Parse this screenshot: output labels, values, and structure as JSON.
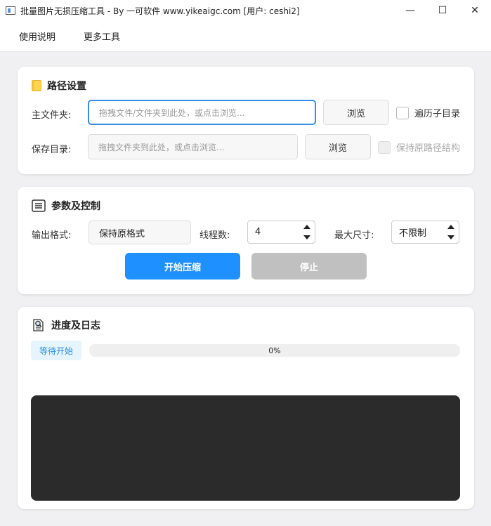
{
  "window": {
    "title": "批量图片无损压缩工具 - By 一可软件 www.yikeaigc.com [用户: ceshi2]",
    "minimize_glyph": "—",
    "maximize_glyph": "☐",
    "close_glyph": "✕"
  },
  "menu": {
    "items": [
      {
        "label": "使用说明"
      },
      {
        "label": "更多工具"
      }
    ]
  },
  "path_settings": {
    "title": "路径设置",
    "title_icon": "folder-icon",
    "main_folder_label": "主文件夹:",
    "main_folder_placeholder": "拖拽文件/文件夹到此处，或点击浏览...",
    "browse_label": "浏览",
    "recursive_label": "遍历子目录",
    "save_dir_label": "保存目录:",
    "save_dir_placeholder": "拖拽文件夹到此处，或点击浏览...",
    "save_browse_label": "浏览",
    "keep_structure_label": "保持原路径结构"
  },
  "params": {
    "title": "参数及控制",
    "title_icon": "list-icon",
    "format_label": "输出格式:",
    "format_value": "保持原格式",
    "threads_label": "线程数:",
    "threads_value": "4",
    "max_size_label": "最大尺寸:",
    "max_size_value": "不限制",
    "start_label": "开始压缩",
    "stop_label": "停止"
  },
  "progress": {
    "title": "进度及日志",
    "title_icon": "magnifier-document-icon",
    "status": "等待开始",
    "percent_text": "0%",
    "percent_value": 0
  },
  "colors": {
    "accent": "#1e90ff",
    "disabled_button": "#c0c0c0",
    "log_background": "#2b2b2b",
    "badge_text": "#2b8fd8"
  }
}
